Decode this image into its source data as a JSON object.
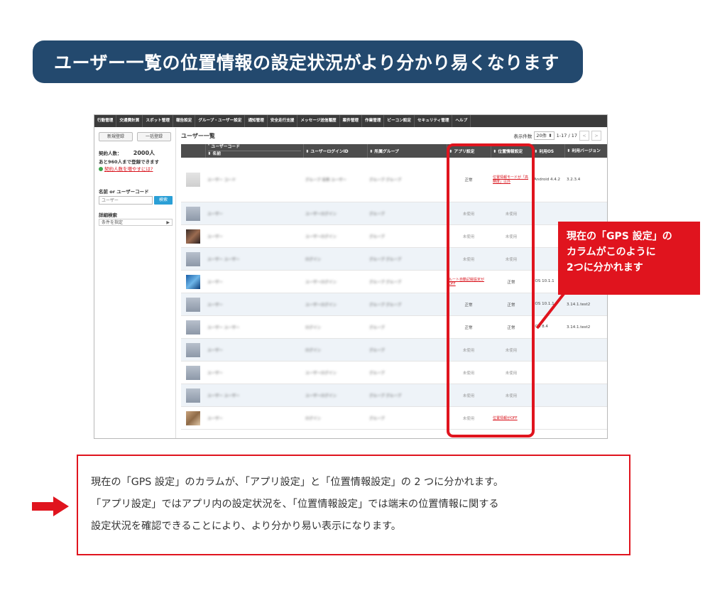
{
  "banner": {
    "title": "ユーザー一覧の位置情報の設定状況がより分かり易くなります"
  },
  "nav": [
    "行動管理",
    "交通費計算",
    "スポット管理",
    "報告設定",
    "グループ・ユーザー設定",
    "通知管理",
    "安全走行支援",
    "メッセージ送信履歴",
    "案件管理",
    "作業管理",
    "ビーコン設定",
    "セキュリティ管理",
    "ヘルプ"
  ],
  "sidebar": {
    "new_btn": "新規登録",
    "bulk_btn": "一括登録",
    "contract_label": "契約人数：",
    "contract_value": "2000人",
    "remaining": "あと960人まで登録できます",
    "increase_link": "契約人数を増やすには?",
    "search_label": "名前 or ユーザーコード",
    "search_placeholder": "ユーザー",
    "search_btn": "検索",
    "detail_label": "詳細検索",
    "detail_select": "条件を指定"
  },
  "main": {
    "title": "ユーザー一覧",
    "display_count_label": "表示件数",
    "per_page": "20件",
    "range": "1-17 / 17",
    "prev": "<",
    "next": ">"
  },
  "columns": {
    "user_code": "ユーザーコード",
    "name": "名前",
    "login_id": "ユーザーログインID",
    "group": "所属グループ",
    "app_setting": "アプリ設定",
    "location_setting": "位置情報設定",
    "os": "利用OS",
    "version": "利用バージョン"
  },
  "rows": [
    {
      "app": "正常",
      "loc": "位置情報モードが「高精度」以外",
      "os": "Android 4.4.2",
      "ver": "3.2.3.4",
      "av": "pale",
      "blur1": "ユーザー コード",
      "blur2": "グループ 名称 ユーザー",
      "blur3": "グループ グループ"
    },
    {
      "app": "未使用",
      "loc": "未使用",
      "os": "",
      "ver": "",
      "av": "",
      "blur1": "ユーザー",
      "blur2": "ユーザーログイン",
      "blur3": "グループ"
    },
    {
      "app": "未使用",
      "loc": "未使用",
      "os": "",
      "ver": "",
      "av": "photo",
      "blur1": "ユーザー",
      "blur2": "ユーザーログイン",
      "blur3": "グループ"
    },
    {
      "app": "未使用",
      "loc": "未使用",
      "os": "",
      "ver": "",
      "av": "",
      "blur1": "ユーザー ユーザー",
      "blur2": "ログイン",
      "blur3": "グループ グループ"
    },
    {
      "app": "ルート自動記録設定がOFF",
      "loc": "正常",
      "os": "iOS 10.1.1",
      "ver": "3.14.1.test2",
      "av": "blue",
      "blur1": "ユーザー",
      "blur2": "ユーザーログイン",
      "blur3": "グループ グループ"
    },
    {
      "app": "正常",
      "loc": "正常",
      "os": "iOS 10.1.1",
      "ver": "3.14.1.test2",
      "av": "",
      "blur1": "ユーザー",
      "blur2": "ユーザーログイン",
      "blur3": "グループ グループ"
    },
    {
      "app": "正常",
      "loc": "正常",
      "os": "iOS 8.4",
      "ver": "3.14.1.test2",
      "av": "",
      "blur1": "ユーザー ユーザー",
      "blur2": "ログイン",
      "blur3": "グループ"
    },
    {
      "app": "未使用",
      "loc": "未使用",
      "os": "",
      "ver": "",
      "av": "",
      "blur1": "ユーザー",
      "blur2": "ログイン",
      "blur3": "グループ"
    },
    {
      "app": "未使用",
      "loc": "未使用",
      "os": "",
      "ver": "",
      "av": "",
      "blur1": "ユーザー",
      "blur2": "ユーザーログイン",
      "blur3": "グループ"
    },
    {
      "app": "未使用",
      "loc": "未使用",
      "os": "",
      "ver": "",
      "av": "",
      "blur1": "ユーザー ユーザー",
      "blur2": "ユーザーログイン",
      "blur3": "グループ グループ"
    },
    {
      "app": "未使用",
      "loc": "位置情報がOFF",
      "os": "",
      "ver": "",
      "av": "tan",
      "blur1": "ユーザー",
      "blur2": "ログイン",
      "blur3": "グループ"
    }
  ],
  "callout": {
    "line1": "現在の「GPS 設定」の",
    "line2": "カラムがこのように",
    "line3": "2つに分かれます"
  },
  "note": {
    "line1": "現在の「GPS 設定」のカラムが、「アプリ設定」と「位置情報設定」の 2 つに分かれます。",
    "line2": "「アプリ設定」ではアプリ内の設定状況を、「位置情報設定」では端末の位置情報に関する",
    "line3": "設定状況を確認できることにより、より分かり易い表示になります。"
  },
  "colors": {
    "navy": "#23496e",
    "accent_red": "#e0141e"
  },
  "icons": {
    "arrow": "right-arrow-icon",
    "avatar": "avatar-icon"
  }
}
